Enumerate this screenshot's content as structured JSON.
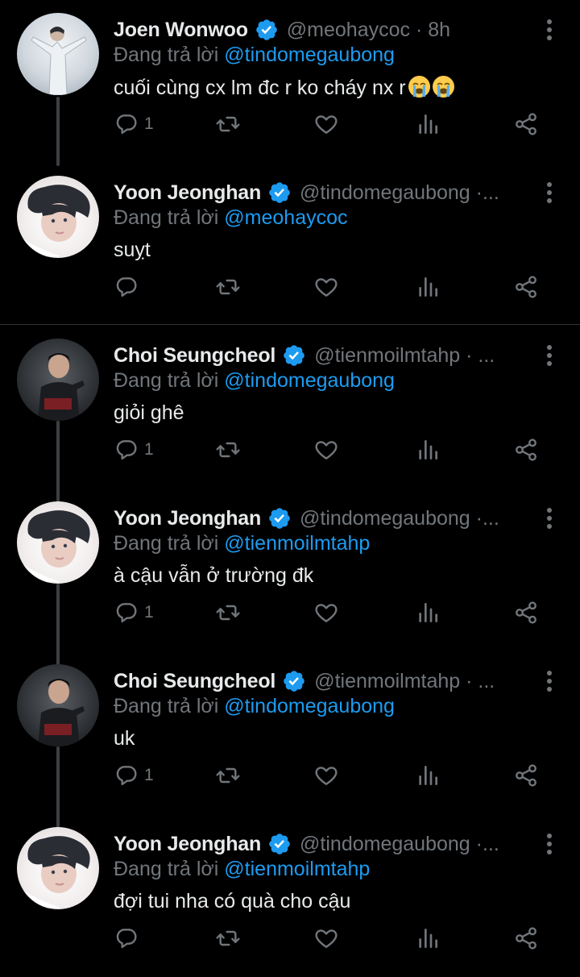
{
  "reply_prefix": "Đang trả lời",
  "tweets": [
    {
      "name": "Joen Wonwoo",
      "handle": "@meohaycoc · 8h",
      "replying_to": "@tindomegaubong",
      "text": "cuối cùng cx lm đc r ko cháy nx r",
      "emojis": [
        "loudly-crying-face",
        "loudly-crying-face"
      ],
      "reply_count": "1",
      "avatar": "wonwoo"
    },
    {
      "name": "Yoon Jeonghan",
      "handle": "@tindomegaubong ·...",
      "replying_to": "@meohaycoc",
      "text": "suỵt",
      "reply_count": "",
      "avatar": "jeonghan"
    },
    {
      "name": "Choi Seungcheol",
      "handle": "@tienmoilmtahp · ...",
      "replying_to": "@tindomegaubong",
      "text": "giỏi ghê",
      "reply_count": "1",
      "avatar": "seungcheol"
    },
    {
      "name": "Yoon Jeonghan",
      "handle": "@tindomegaubong ·...",
      "replying_to": "@tienmoilmtahp",
      "text": "à cậu vẫn ở trường đk",
      "reply_count": "1",
      "avatar": "jeonghan"
    },
    {
      "name": "Choi Seungcheol",
      "handle": "@tienmoilmtahp · ...",
      "replying_to": "@tindomegaubong",
      "text": "uk",
      "reply_count": "1",
      "avatar": "seungcheol"
    },
    {
      "name": "Yoon Jeonghan",
      "handle": "@tindomegaubong ·...",
      "replying_to": "@tienmoilmtahp",
      "text": "đợi tui nha có quà cho cậu",
      "reply_count": "",
      "avatar": "jeonghan"
    }
  ],
  "icons": {
    "verified": "verified-badge-icon",
    "more": "more-options-icon",
    "reply": "reply-icon",
    "retweet": "retweet-icon",
    "like": "heart-icon",
    "views": "analytics-icon",
    "share": "share-icon"
  },
  "colors": {
    "background": "#000000",
    "text": "#e7e9ea",
    "muted": "#71767b",
    "accent": "#1d9bf0"
  }
}
